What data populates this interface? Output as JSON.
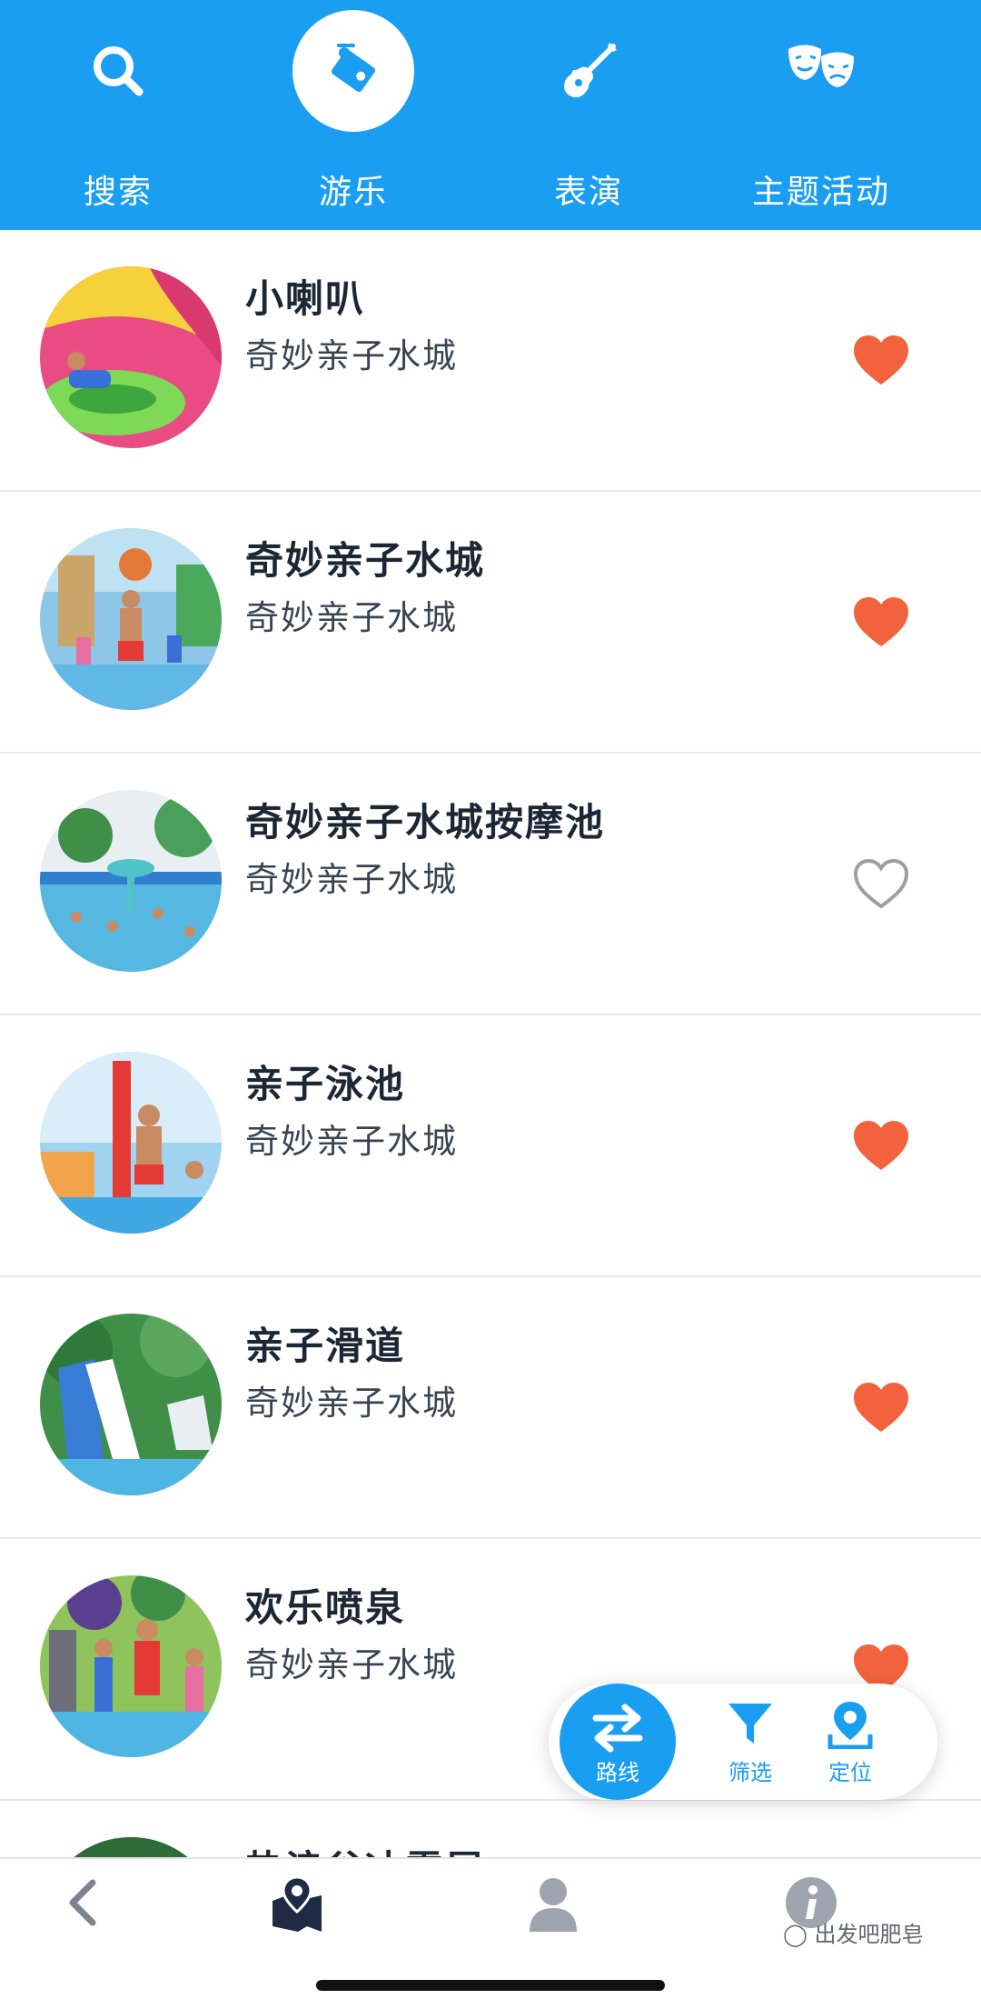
{
  "top_nav": {
    "items": [
      {
        "label": "搜索",
        "icon": "search-icon",
        "active": false
      },
      {
        "label": "游乐",
        "icon": "ride-tag-icon",
        "active": true
      },
      {
        "label": "表演",
        "icon": "guitar-icon",
        "active": false
      },
      {
        "label": "主题活动",
        "icon": "theater-masks-icon",
        "active": false
      }
    ]
  },
  "attractions": [
    {
      "title": "小喇叭",
      "subtitle": "奇妙亲子水城",
      "favorite": true
    },
    {
      "title": "奇妙亲子水城",
      "subtitle": "奇妙亲子水城",
      "favorite": true
    },
    {
      "title": "奇妙亲子水城按摩池",
      "subtitle": "奇妙亲子水城",
      "favorite": false
    },
    {
      "title": "亲子泳池",
      "subtitle": "奇妙亲子水城",
      "favorite": true
    },
    {
      "title": "亲子滑道",
      "subtitle": "奇妙亲子水城",
      "favorite": true
    },
    {
      "title": "欢乐喷泉",
      "subtitle": "奇妙亲子水城",
      "favorite": true
    },
    {
      "title": "热浪谷冰雪屋",
      "subtitle": "",
      "favorite": false
    }
  ],
  "fab": {
    "route_label": "路线",
    "filter_label": "筛选",
    "locate_label": "定位"
  },
  "bottom_bar": {
    "watermark": "出发吧肥皂"
  },
  "colors": {
    "primary": "#1a9ef2",
    "favorite": "#f2623c",
    "favorite_outline": "#9aa0a6"
  }
}
